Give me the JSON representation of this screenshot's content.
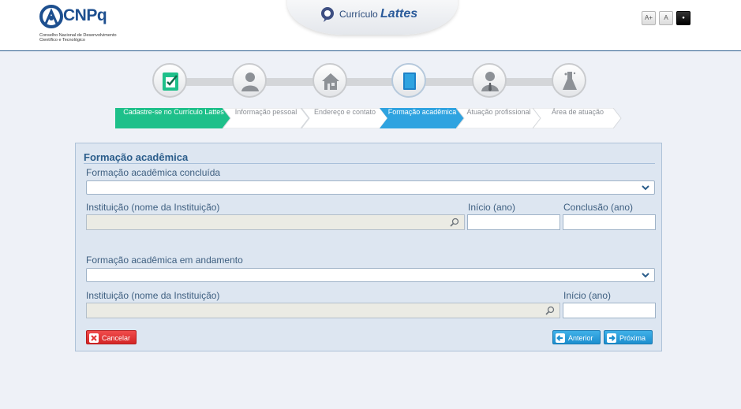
{
  "header": {
    "logo_text": "CNPq",
    "logo_subtitle": "Conselho Nacional de Desenvolvimento Científico e Tecnológico",
    "app_title_prefix": "Currículo",
    "app_title_main": "Lattes",
    "font_buttons": [
      "A+",
      "A",
      "●"
    ]
  },
  "steps": [
    {
      "icon": "clipboard-check-icon",
      "label": "Cadastre-se no Currículo Lattes",
      "state": "done"
    },
    {
      "icon": "person-icon",
      "label": "Informação pessoal",
      "state": "pending"
    },
    {
      "icon": "house-icon",
      "label": "Endereço e contato",
      "state": "pending"
    },
    {
      "icon": "book-icon",
      "label": "Formação acadêmica",
      "state": "active"
    },
    {
      "icon": "person-tie-icon",
      "label": "Atuação profissional",
      "state": "pending"
    },
    {
      "icon": "flask-icon",
      "label": "Área de atuação",
      "state": "pending"
    }
  ],
  "form": {
    "title": "Formação acadêmica",
    "completed_label": "Formação acadêmica concluída",
    "completed_select_value": "",
    "institution_label_1": "Instituição (nome da Instituição)",
    "start_label_1": "Início (ano)",
    "end_label_1": "Conclusão (ano)",
    "ongoing_label": "Formação acadêmica em andamento",
    "ongoing_select_value": "",
    "institution_label_2": "Instituição (nome da Instituição)",
    "start_label_2": "Início (ano)",
    "cancel_label": "Cancelar",
    "previous_label": "Anterior",
    "next_label": "Próxima"
  },
  "colors": {
    "accent_green": "#1ec08a",
    "accent_blue": "#2fa3e0",
    "cancel_red": "#e23434",
    "header_border": "#2d5f8e"
  }
}
